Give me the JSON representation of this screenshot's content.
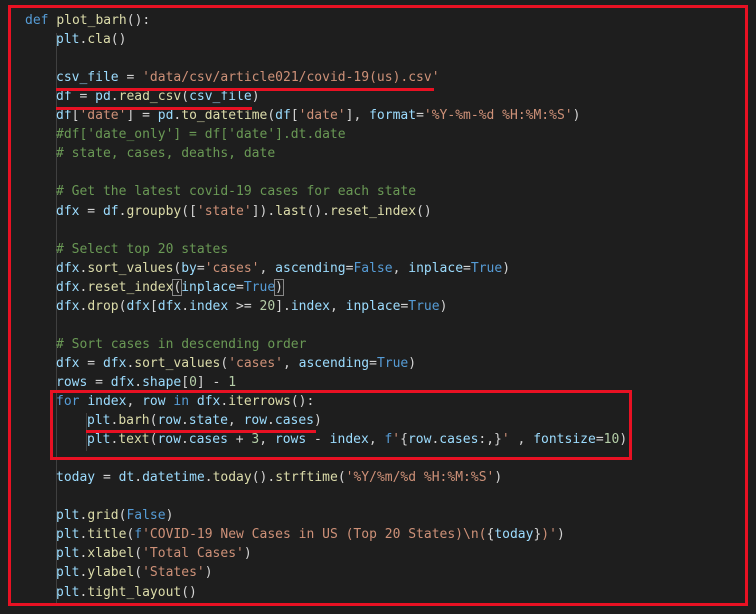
{
  "code_lines": [
    {
      "indent": 0,
      "tokens": [
        [
          "kw",
          "def "
        ],
        [
          "fn",
          "plot_barh"
        ],
        [
          "punc",
          "():"
        ]
      ]
    },
    {
      "indent": 1,
      "tokens": [
        [
          "var",
          "plt"
        ],
        [
          "punc",
          "."
        ],
        [
          "fn",
          "cla"
        ],
        [
          "punc",
          "()"
        ]
      ]
    },
    {
      "indent": 1,
      "tokens": []
    },
    {
      "indent": 1,
      "tokens": [
        [
          "var",
          "csv_file"
        ],
        [
          "punc",
          " = "
        ],
        [
          "str",
          "'data/csv/article021/covid-19(us).csv'"
        ]
      ]
    },
    {
      "indent": 1,
      "tokens": [
        [
          "var",
          "df"
        ],
        [
          "punc",
          " = "
        ],
        [
          "var",
          "pd"
        ],
        [
          "punc",
          "."
        ],
        [
          "fn",
          "read_csv"
        ],
        [
          "punc",
          "("
        ],
        [
          "var",
          "csv_file"
        ],
        [
          "punc",
          ")"
        ]
      ]
    },
    {
      "indent": 1,
      "tokens": [
        [
          "var",
          "df"
        ],
        [
          "punc",
          "["
        ],
        [
          "str",
          "'date'"
        ],
        [
          "punc",
          "] = "
        ],
        [
          "var",
          "pd"
        ],
        [
          "punc",
          "."
        ],
        [
          "fn",
          "to_datetime"
        ],
        [
          "punc",
          "("
        ],
        [
          "var",
          "df"
        ],
        [
          "punc",
          "["
        ],
        [
          "str",
          "'date'"
        ],
        [
          "punc",
          "], "
        ],
        [
          "var",
          "format"
        ],
        [
          "punc",
          "="
        ],
        [
          "str",
          "'%Y-%m-%d %H:%M:%S'"
        ],
        [
          "punc",
          ")"
        ]
      ]
    },
    {
      "indent": 1,
      "tokens": [
        [
          "cm",
          "#df['date_only'] = df['date'].dt.date"
        ]
      ]
    },
    {
      "indent": 1,
      "tokens": [
        [
          "cm",
          "# state, cases, deaths, date"
        ]
      ]
    },
    {
      "indent": 1,
      "tokens": []
    },
    {
      "indent": 1,
      "tokens": [
        [
          "cm",
          "# Get the latest covid-19 cases for each state"
        ]
      ]
    },
    {
      "indent": 1,
      "tokens": [
        [
          "var",
          "dfx"
        ],
        [
          "punc",
          " = "
        ],
        [
          "var",
          "df"
        ],
        [
          "punc",
          "."
        ],
        [
          "fn",
          "groupby"
        ],
        [
          "punc",
          "(["
        ],
        [
          "str",
          "'state'"
        ],
        [
          "punc",
          "])."
        ],
        [
          "fn",
          "last"
        ],
        [
          "punc",
          "()."
        ],
        [
          "fn",
          "reset_index"
        ],
        [
          "punc",
          "()"
        ]
      ]
    },
    {
      "indent": 1,
      "tokens": []
    },
    {
      "indent": 1,
      "tokens": [
        [
          "cm",
          "# Select top 20 states"
        ]
      ]
    },
    {
      "indent": 1,
      "tokens": [
        [
          "var",
          "dfx"
        ],
        [
          "punc",
          "."
        ],
        [
          "fn",
          "sort_values"
        ],
        [
          "punc",
          "("
        ],
        [
          "var",
          "by"
        ],
        [
          "punc",
          "="
        ],
        [
          "str",
          "'cases'"
        ],
        [
          "punc",
          ", "
        ],
        [
          "var",
          "ascending"
        ],
        [
          "punc",
          "="
        ],
        [
          "kw",
          "False"
        ],
        [
          "punc",
          ", "
        ],
        [
          "var",
          "inplace"
        ],
        [
          "punc",
          "="
        ],
        [
          "kw",
          "True"
        ],
        [
          "punc",
          ")"
        ]
      ]
    },
    {
      "indent": 1,
      "tokens": [
        [
          "var",
          "dfx"
        ],
        [
          "punc",
          "."
        ],
        [
          "fn",
          "reset_index"
        ],
        [
          "box",
          "("
        ],
        [
          "var",
          "inplace"
        ],
        [
          "punc",
          "="
        ],
        [
          "kw",
          "True"
        ],
        [
          "box",
          ")"
        ]
      ]
    },
    {
      "indent": 1,
      "tokens": [
        [
          "var",
          "dfx"
        ],
        [
          "punc",
          "."
        ],
        [
          "fn",
          "drop"
        ],
        [
          "punc",
          "("
        ],
        [
          "var",
          "dfx"
        ],
        [
          "punc",
          "["
        ],
        [
          "var",
          "dfx"
        ],
        [
          "punc",
          "."
        ],
        [
          "var",
          "index"
        ],
        [
          "punc",
          " >= "
        ],
        [
          "num",
          "20"
        ],
        [
          "punc",
          "]."
        ],
        [
          "var",
          "index"
        ],
        [
          "punc",
          ", "
        ],
        [
          "var",
          "inplace"
        ],
        [
          "punc",
          "="
        ],
        [
          "kw",
          "True"
        ],
        [
          "punc",
          ")"
        ]
      ]
    },
    {
      "indent": 1,
      "tokens": []
    },
    {
      "indent": 1,
      "tokens": [
        [
          "cm",
          "# Sort cases in descending order"
        ]
      ]
    },
    {
      "indent": 1,
      "tokens": [
        [
          "var",
          "dfx"
        ],
        [
          "punc",
          " = "
        ],
        [
          "var",
          "dfx"
        ],
        [
          "punc",
          "."
        ],
        [
          "fn",
          "sort_values"
        ],
        [
          "punc",
          "("
        ],
        [
          "str",
          "'cases'"
        ],
        [
          "punc",
          ", "
        ],
        [
          "var",
          "ascending"
        ],
        [
          "punc",
          "="
        ],
        [
          "kw",
          "True"
        ],
        [
          "punc",
          ")"
        ]
      ]
    },
    {
      "indent": 1,
      "tokens": [
        [
          "var",
          "rows"
        ],
        [
          "punc",
          " = "
        ],
        [
          "var",
          "dfx"
        ],
        [
          "punc",
          "."
        ],
        [
          "var",
          "shape"
        ],
        [
          "punc",
          "["
        ],
        [
          "num",
          "0"
        ],
        [
          "punc",
          "] - "
        ],
        [
          "num",
          "1"
        ]
      ]
    },
    {
      "indent": 1,
      "tokens": [
        [
          "kw",
          "for "
        ],
        [
          "var",
          "index"
        ],
        [
          "punc",
          ", "
        ],
        [
          "var",
          "row"
        ],
        [
          "kw",
          " in "
        ],
        [
          "var",
          "dfx"
        ],
        [
          "punc",
          "."
        ],
        [
          "fn",
          "iterrows"
        ],
        [
          "punc",
          "():"
        ]
      ]
    },
    {
      "indent": 2,
      "tokens": [
        [
          "var",
          "plt"
        ],
        [
          "punc",
          "."
        ],
        [
          "fn",
          "barh"
        ],
        [
          "punc",
          "("
        ],
        [
          "var",
          "row"
        ],
        [
          "punc",
          "."
        ],
        [
          "var",
          "state"
        ],
        [
          "punc",
          ", "
        ],
        [
          "var",
          "row"
        ],
        [
          "punc",
          "."
        ],
        [
          "var",
          "cases"
        ],
        [
          "punc",
          ")"
        ]
      ]
    },
    {
      "indent": 2,
      "tokens": [
        [
          "var",
          "plt"
        ],
        [
          "punc",
          "."
        ],
        [
          "fn",
          "text"
        ],
        [
          "punc",
          "("
        ],
        [
          "var",
          "row"
        ],
        [
          "punc",
          "."
        ],
        [
          "var",
          "cases"
        ],
        [
          "punc",
          " + "
        ],
        [
          "num",
          "3"
        ],
        [
          "punc",
          ", "
        ],
        [
          "var",
          "rows"
        ],
        [
          "punc",
          " - "
        ],
        [
          "var",
          "index"
        ],
        [
          "punc",
          ", "
        ],
        [
          "kw",
          "f"
        ],
        [
          "str",
          "'"
        ],
        [
          "punc",
          "{"
        ],
        [
          "var",
          "row"
        ],
        [
          "punc",
          "."
        ],
        [
          "var",
          "cases"
        ],
        [
          "punc",
          ":,}"
        ],
        [
          "str",
          "'"
        ],
        [
          "punc",
          " , "
        ],
        [
          "var",
          "fontsize"
        ],
        [
          "punc",
          "="
        ],
        [
          "num",
          "10"
        ],
        [
          "punc",
          ")"
        ]
      ]
    },
    {
      "indent": 1,
      "tokens": []
    },
    {
      "indent": 1,
      "tokens": [
        [
          "var",
          "today"
        ],
        [
          "punc",
          " = "
        ],
        [
          "var",
          "dt"
        ],
        [
          "punc",
          "."
        ],
        [
          "var",
          "datetime"
        ],
        [
          "punc",
          "."
        ],
        [
          "fn",
          "today"
        ],
        [
          "punc",
          "()."
        ],
        [
          "fn",
          "strftime"
        ],
        [
          "punc",
          "("
        ],
        [
          "str",
          "'%Y/%m/%d %H:%M:%S'"
        ],
        [
          "punc",
          ")"
        ]
      ]
    },
    {
      "indent": 1,
      "tokens": []
    },
    {
      "indent": 1,
      "tokens": [
        [
          "var",
          "plt"
        ],
        [
          "punc",
          "."
        ],
        [
          "fn",
          "grid"
        ],
        [
          "punc",
          "("
        ],
        [
          "kw",
          "False"
        ],
        [
          "punc",
          ")"
        ]
      ]
    },
    {
      "indent": 1,
      "tokens": [
        [
          "var",
          "plt"
        ],
        [
          "punc",
          "."
        ],
        [
          "fn",
          "title"
        ],
        [
          "punc",
          "("
        ],
        [
          "kw",
          "f"
        ],
        [
          "str",
          "'COVID-19 New Cases in US (Top 20 States)\\n("
        ],
        [
          "punc",
          "{"
        ],
        [
          "var",
          "today"
        ],
        [
          "punc",
          "}"
        ],
        [
          "str",
          ")'"
        ],
        [
          "punc",
          ")"
        ]
      ]
    },
    {
      "indent": 1,
      "tokens": [
        [
          "var",
          "plt"
        ],
        [
          "punc",
          "."
        ],
        [
          "fn",
          "xlabel"
        ],
        [
          "punc",
          "("
        ],
        [
          "str",
          "'Total Cases'"
        ],
        [
          "punc",
          ")"
        ]
      ]
    },
    {
      "indent": 1,
      "tokens": [
        [
          "var",
          "plt"
        ],
        [
          "punc",
          "."
        ],
        [
          "fn",
          "ylabel"
        ],
        [
          "punc",
          "("
        ],
        [
          "str",
          "'States'"
        ],
        [
          "punc",
          ")"
        ]
      ]
    },
    {
      "indent": 1,
      "tokens": [
        [
          "var",
          "plt"
        ],
        [
          "punc",
          "."
        ],
        [
          "fn",
          "tight_layout"
        ],
        [
          "punc",
          "()"
        ]
      ]
    }
  ],
  "colors": {
    "background": "#1e1e1e",
    "highlight_red": "#e81123",
    "keyword": "#569cd6",
    "function": "#dcdcaa",
    "variable": "#9cdcfe",
    "string": "#ce9178",
    "number": "#b5cea8",
    "comment": "#6a9955",
    "text": "#d4d4d4"
  }
}
